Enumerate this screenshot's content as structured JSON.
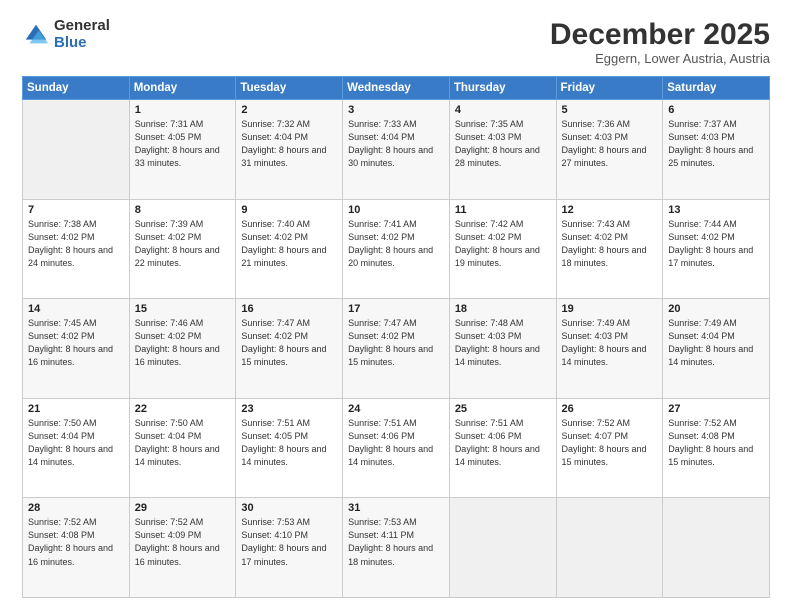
{
  "logo": {
    "general": "General",
    "blue": "Blue"
  },
  "header": {
    "month": "December 2025",
    "location": "Eggern, Lower Austria, Austria"
  },
  "weekdays": [
    "Sunday",
    "Monday",
    "Tuesday",
    "Wednesday",
    "Thursday",
    "Friday",
    "Saturday"
  ],
  "weeks": [
    [
      {
        "day": "",
        "sunrise": "",
        "sunset": "",
        "daylight": ""
      },
      {
        "day": "1",
        "sunrise": "Sunrise: 7:31 AM",
        "sunset": "Sunset: 4:05 PM",
        "daylight": "Daylight: 8 hours and 33 minutes."
      },
      {
        "day": "2",
        "sunrise": "Sunrise: 7:32 AM",
        "sunset": "Sunset: 4:04 PM",
        "daylight": "Daylight: 8 hours and 31 minutes."
      },
      {
        "day": "3",
        "sunrise": "Sunrise: 7:33 AM",
        "sunset": "Sunset: 4:04 PM",
        "daylight": "Daylight: 8 hours and 30 minutes."
      },
      {
        "day": "4",
        "sunrise": "Sunrise: 7:35 AM",
        "sunset": "Sunset: 4:03 PM",
        "daylight": "Daylight: 8 hours and 28 minutes."
      },
      {
        "day": "5",
        "sunrise": "Sunrise: 7:36 AM",
        "sunset": "Sunset: 4:03 PM",
        "daylight": "Daylight: 8 hours and 27 minutes."
      },
      {
        "day": "6",
        "sunrise": "Sunrise: 7:37 AM",
        "sunset": "Sunset: 4:03 PM",
        "daylight": "Daylight: 8 hours and 25 minutes."
      }
    ],
    [
      {
        "day": "7",
        "sunrise": "Sunrise: 7:38 AM",
        "sunset": "Sunset: 4:02 PM",
        "daylight": "Daylight: 8 hours and 24 minutes."
      },
      {
        "day": "8",
        "sunrise": "Sunrise: 7:39 AM",
        "sunset": "Sunset: 4:02 PM",
        "daylight": "Daylight: 8 hours and 22 minutes."
      },
      {
        "day": "9",
        "sunrise": "Sunrise: 7:40 AM",
        "sunset": "Sunset: 4:02 PM",
        "daylight": "Daylight: 8 hours and 21 minutes."
      },
      {
        "day": "10",
        "sunrise": "Sunrise: 7:41 AM",
        "sunset": "Sunset: 4:02 PM",
        "daylight": "Daylight: 8 hours and 20 minutes."
      },
      {
        "day": "11",
        "sunrise": "Sunrise: 7:42 AM",
        "sunset": "Sunset: 4:02 PM",
        "daylight": "Daylight: 8 hours and 19 minutes."
      },
      {
        "day": "12",
        "sunrise": "Sunrise: 7:43 AM",
        "sunset": "Sunset: 4:02 PM",
        "daylight": "Daylight: 8 hours and 18 minutes."
      },
      {
        "day": "13",
        "sunrise": "Sunrise: 7:44 AM",
        "sunset": "Sunset: 4:02 PM",
        "daylight": "Daylight: 8 hours and 17 minutes."
      }
    ],
    [
      {
        "day": "14",
        "sunrise": "Sunrise: 7:45 AM",
        "sunset": "Sunset: 4:02 PM",
        "daylight": "Daylight: 8 hours and 16 minutes."
      },
      {
        "day": "15",
        "sunrise": "Sunrise: 7:46 AM",
        "sunset": "Sunset: 4:02 PM",
        "daylight": "Daylight: 8 hours and 16 minutes."
      },
      {
        "day": "16",
        "sunrise": "Sunrise: 7:47 AM",
        "sunset": "Sunset: 4:02 PM",
        "daylight": "Daylight: 8 hours and 15 minutes."
      },
      {
        "day": "17",
        "sunrise": "Sunrise: 7:47 AM",
        "sunset": "Sunset: 4:02 PM",
        "daylight": "Daylight: 8 hours and 15 minutes."
      },
      {
        "day": "18",
        "sunrise": "Sunrise: 7:48 AM",
        "sunset": "Sunset: 4:03 PM",
        "daylight": "Daylight: 8 hours and 14 minutes."
      },
      {
        "day": "19",
        "sunrise": "Sunrise: 7:49 AM",
        "sunset": "Sunset: 4:03 PM",
        "daylight": "Daylight: 8 hours and 14 minutes."
      },
      {
        "day": "20",
        "sunrise": "Sunrise: 7:49 AM",
        "sunset": "Sunset: 4:04 PM",
        "daylight": "Daylight: 8 hours and 14 minutes."
      }
    ],
    [
      {
        "day": "21",
        "sunrise": "Sunrise: 7:50 AM",
        "sunset": "Sunset: 4:04 PM",
        "daylight": "Daylight: 8 hours and 14 minutes."
      },
      {
        "day": "22",
        "sunrise": "Sunrise: 7:50 AM",
        "sunset": "Sunset: 4:04 PM",
        "daylight": "Daylight: 8 hours and 14 minutes."
      },
      {
        "day": "23",
        "sunrise": "Sunrise: 7:51 AM",
        "sunset": "Sunset: 4:05 PM",
        "daylight": "Daylight: 8 hours and 14 minutes."
      },
      {
        "day": "24",
        "sunrise": "Sunrise: 7:51 AM",
        "sunset": "Sunset: 4:06 PM",
        "daylight": "Daylight: 8 hours and 14 minutes."
      },
      {
        "day": "25",
        "sunrise": "Sunrise: 7:51 AM",
        "sunset": "Sunset: 4:06 PM",
        "daylight": "Daylight: 8 hours and 14 minutes."
      },
      {
        "day": "26",
        "sunrise": "Sunrise: 7:52 AM",
        "sunset": "Sunset: 4:07 PM",
        "daylight": "Daylight: 8 hours and 15 minutes."
      },
      {
        "day": "27",
        "sunrise": "Sunrise: 7:52 AM",
        "sunset": "Sunset: 4:08 PM",
        "daylight": "Daylight: 8 hours and 15 minutes."
      }
    ],
    [
      {
        "day": "28",
        "sunrise": "Sunrise: 7:52 AM",
        "sunset": "Sunset: 4:08 PM",
        "daylight": "Daylight: 8 hours and 16 minutes."
      },
      {
        "day": "29",
        "sunrise": "Sunrise: 7:52 AM",
        "sunset": "Sunset: 4:09 PM",
        "daylight": "Daylight: 8 hours and 16 minutes."
      },
      {
        "day": "30",
        "sunrise": "Sunrise: 7:53 AM",
        "sunset": "Sunset: 4:10 PM",
        "daylight": "Daylight: 8 hours and 17 minutes."
      },
      {
        "day": "31",
        "sunrise": "Sunrise: 7:53 AM",
        "sunset": "Sunset: 4:11 PM",
        "daylight": "Daylight: 8 hours and 18 minutes."
      },
      {
        "day": "",
        "sunrise": "",
        "sunset": "",
        "daylight": ""
      },
      {
        "day": "",
        "sunrise": "",
        "sunset": "",
        "daylight": ""
      },
      {
        "day": "",
        "sunrise": "",
        "sunset": "",
        "daylight": ""
      }
    ]
  ]
}
